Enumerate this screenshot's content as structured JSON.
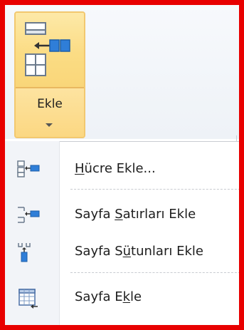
{
  "ribbon": {
    "ekle_button": {
      "label": "Ekle",
      "icon": "insert-cells-icon"
    }
  },
  "menu": {
    "items": [
      {
        "label_pre": "",
        "mnemonic": "H",
        "label_post": "ücre Ekle...",
        "icon": "insert-cells-icon"
      },
      {
        "label_pre": "Sayfa ",
        "mnemonic": "S",
        "label_post": "atırları Ekle",
        "icon": "insert-sheet-rows-icon"
      },
      {
        "label_pre": "Sayfa S",
        "mnemonic": "ü",
        "label_post": "tunları Ekle",
        "icon": "insert-sheet-columns-icon"
      },
      {
        "label_pre": "Sayfa E",
        "mnemonic": "k",
        "label_post": "le",
        "icon": "insert-sheet-icon"
      }
    ]
  },
  "colors": {
    "frame": "#e80000",
    "button_highlight": "#fbdd86",
    "icon_blue": "#2f7ed8"
  }
}
